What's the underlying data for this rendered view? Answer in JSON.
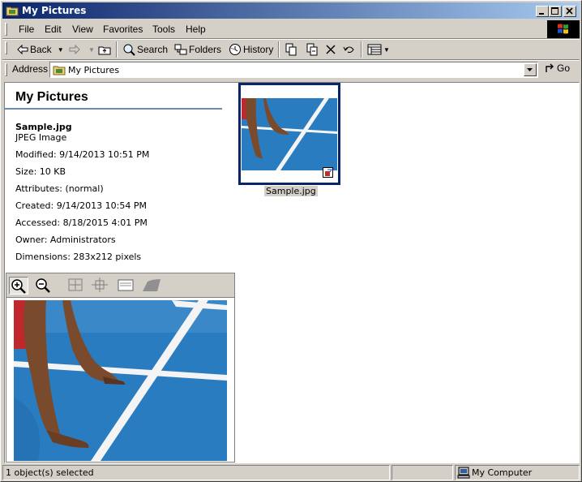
{
  "window": {
    "title": "My Pictures"
  },
  "menu": [
    "File",
    "Edit",
    "View",
    "Favorites",
    "Tools",
    "Help"
  ],
  "toolbar": {
    "back": "Back",
    "search": "Search",
    "folders": "Folders",
    "history": "History"
  },
  "address": {
    "label": "Address",
    "value": "My Pictures",
    "go": "Go"
  },
  "pane": {
    "title": "My Pictures",
    "file_name": "Sample.jpg",
    "file_type": "JPEG Image",
    "details": [
      "Modified: 9/14/2013 10:51 PM",
      "Size: 10 KB",
      "Attributes: (normal)",
      "Created: 9/14/2013 10:54 PM",
      "Accessed: 8/18/2015 4:01 PM",
      "Owner: Administrators",
      "Dimensions: 283x212 pixels"
    ]
  },
  "thumbnail": {
    "label": "Sample.jpg"
  },
  "status": {
    "selection": "1 object(s) selected",
    "zone": "My Computer"
  },
  "icons": [
    "folder-icon",
    "minimize-icon",
    "maximize-icon",
    "close-icon",
    "windows-logo",
    "back-arrow-icon",
    "forward-arrow-icon",
    "up-folder-icon",
    "search-icon",
    "folders-icon",
    "history-icon",
    "move-to-icon",
    "copy-to-icon",
    "delete-icon",
    "undo-icon",
    "views-icon",
    "go-arrow-icon",
    "zoom-in-icon",
    "zoom-out-icon",
    "best-fit-icon",
    "actual-size-icon",
    "slideshow-icon",
    "image-preview-icon",
    "computer-icon"
  ]
}
